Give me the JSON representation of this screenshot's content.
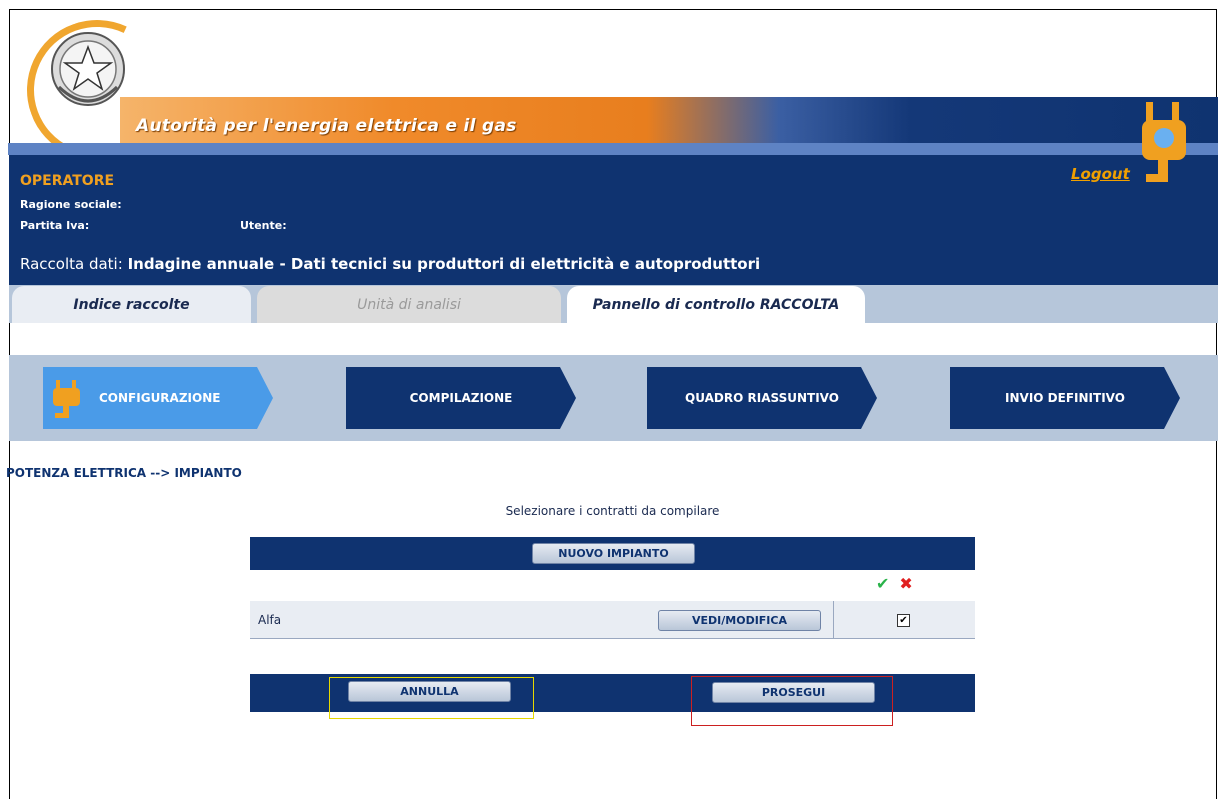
{
  "header": {
    "banner_title": "Autorità per l'energia elettrica e il gas",
    "logout": "Logout",
    "operator_title": "OPERATORE",
    "ragione_sociale_label": "Ragione sociale:",
    "partita_iva_label": "Partita Iva:",
    "utente_label": "Utente:",
    "raccolta_label": "Raccolta dati:",
    "raccolta_value": "Indagine annuale - Dati tecnici su produttori di elettricità e autoproduttori"
  },
  "tabs": [
    {
      "label": "Indice raccolte",
      "state": "normal"
    },
    {
      "label": "Unità di analisi",
      "state": "disabled"
    },
    {
      "label": "Pannello di controllo RACCOLTA",
      "state": "active"
    }
  ],
  "steps": [
    {
      "label": "CONFIGURAZIONE",
      "active": true
    },
    {
      "label": "COMPILAZIONE",
      "active": false
    },
    {
      "label": "QUADRO RIASSUNTIVO",
      "active": false
    },
    {
      "label": "INVIO DEFINITIVO",
      "active": false
    }
  ],
  "breadcrumb": "POTENZA ELETTRICA --> IMPIANTO",
  "instruction": "Selezionare i contratti da compilare",
  "buttons": {
    "nuovo_impianto": "NUOVO IMPIANTO",
    "vedi_modifica": "VEDI/MODIFICA",
    "annulla": "ANNULLA",
    "prosegui": "PROSEGUI"
  },
  "table": {
    "header_icons": [
      "check-icon",
      "cross-icon"
    ],
    "rows": [
      {
        "name": "Alfa",
        "checked": true
      }
    ]
  },
  "colors": {
    "navy": "#0f3370",
    "orange": "#f0a020",
    "step_active": "#4a9be8",
    "tab_bg": "#b6c6da"
  }
}
